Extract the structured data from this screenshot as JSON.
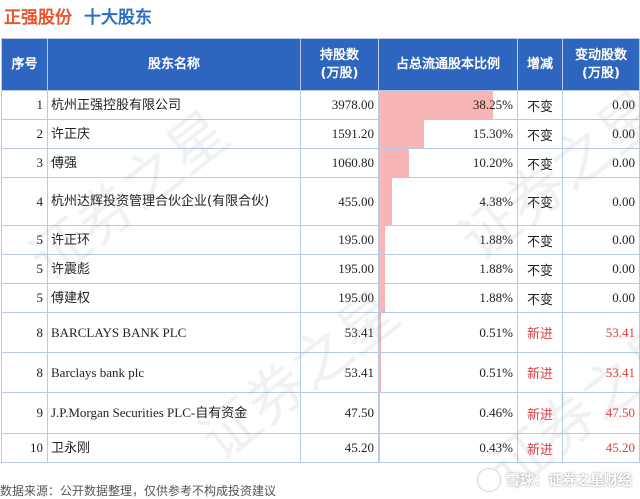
{
  "header": {
    "company": "正强股份",
    "section": "十大股东"
  },
  "table": {
    "columns": [
      "序号",
      "股东名称",
      "持股数\n(万股)",
      "占总流通股本比例",
      "增减",
      "变动股数\n(万股)"
    ],
    "rows": [
      {
        "rank": "1",
        "name": "杭州正强控股有限公司",
        "shares": "3978.00",
        "ratio": "38.25%",
        "ratio_value": 38.25,
        "change": "不变",
        "delta": "0.00"
      },
      {
        "rank": "2",
        "name": "许正庆",
        "shares": "1591.20",
        "ratio": "15.30%",
        "ratio_value": 15.3,
        "change": "不变",
        "delta": "0.00"
      },
      {
        "rank": "3",
        "name": "傅强",
        "shares": "1060.80",
        "ratio": "10.20%",
        "ratio_value": 10.2,
        "change": "不变",
        "delta": "0.00"
      },
      {
        "rank": "4",
        "name": "杭州达辉投资管理合伙企业(有限合伙)",
        "shares": "455.00",
        "ratio": "4.38%",
        "ratio_value": 4.38,
        "change": "不变",
        "delta": "0.00"
      },
      {
        "rank": "5",
        "name": "许正环",
        "shares": "195.00",
        "ratio": "1.88%",
        "ratio_value": 1.88,
        "change": "不变",
        "delta": "0.00"
      },
      {
        "rank": "5",
        "name": "许震彪",
        "shares": "195.00",
        "ratio": "1.88%",
        "ratio_value": 1.88,
        "change": "不变",
        "delta": "0.00"
      },
      {
        "rank": "5",
        "name": "傅建权",
        "shares": "195.00",
        "ratio": "1.88%",
        "ratio_value": 1.88,
        "change": "不变",
        "delta": "0.00"
      },
      {
        "rank": "8",
        "name": "BARCLAYS BANK PLC",
        "shares": "53.41",
        "ratio": "0.51%",
        "ratio_value": 0.51,
        "change": "新进",
        "delta": "53.41"
      },
      {
        "rank": "8",
        "name": "Barclays bank plc",
        "shares": "53.41",
        "ratio": "0.51%",
        "ratio_value": 0.51,
        "change": "新进",
        "delta": "53.41"
      },
      {
        "rank": "9",
        "name": "J.P.Morgan Securities PLC-自有资金",
        "shares": "47.50",
        "ratio": "0.46%",
        "ratio_value": 0.46,
        "change": "新进",
        "delta": "47.50"
      },
      {
        "rank": "10",
        "name": "卫永刚",
        "shares": "45.20",
        "ratio": "0.43%",
        "ratio_value": 0.43,
        "change": "新进",
        "delta": "45.20"
      }
    ]
  },
  "watermark": "证券之星",
  "footer": {
    "source": "数据来源：公开数据整理，仅供参考不构成投资建议",
    "brand": "雪球：证券之星财经"
  },
  "colors": {
    "header_bg": "#2e66bf",
    "bar": "#f7b5b5",
    "new_entry": "#e03c3c",
    "company_title": "#e8542b",
    "section_title": "#2b6fc4"
  }
}
